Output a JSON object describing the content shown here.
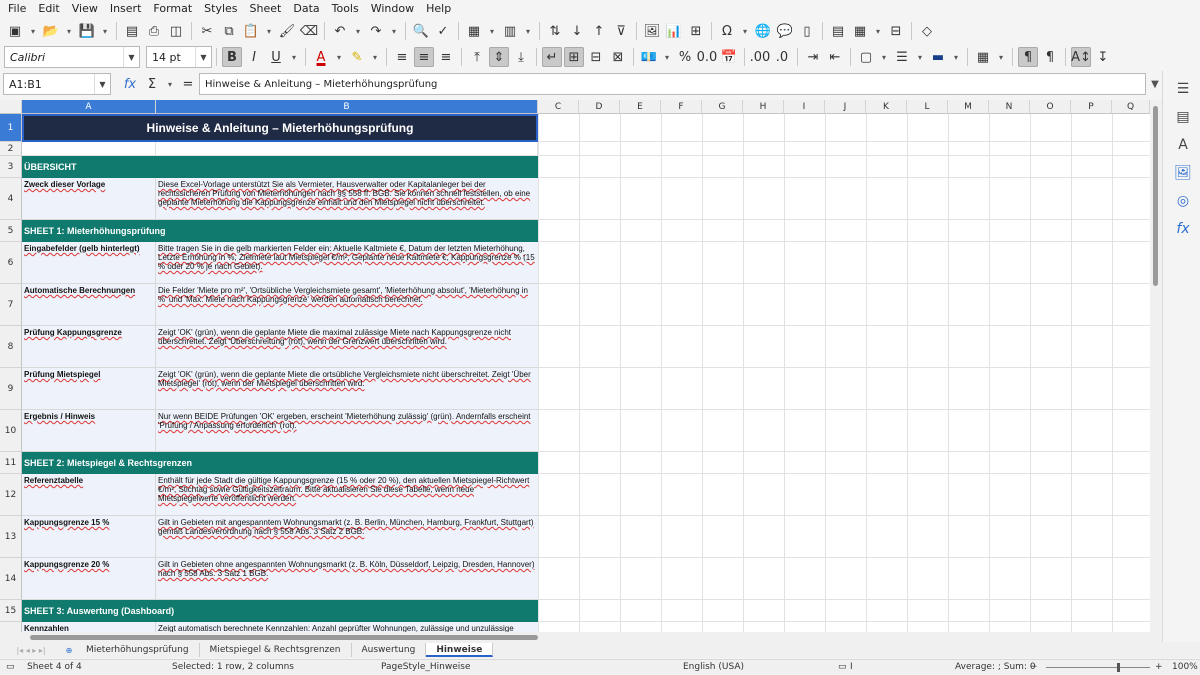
{
  "menu": [
    "File",
    "Edit",
    "View",
    "Insert",
    "Format",
    "Styles",
    "Sheet",
    "Data",
    "Tools",
    "Window",
    "Help"
  ],
  "font": {
    "name": "Calibri",
    "size": "14 pt"
  },
  "name_box": "A1:B1",
  "formula": "Hinweise & Anleitung – Mieterhöhungsprüfung",
  "columns": [
    {
      "label": "A"
    },
    {
      "label": "B"
    },
    {
      "label": "C"
    },
    {
      "label": "D"
    },
    {
      "label": "E"
    },
    {
      "label": "F"
    },
    {
      "label": "G"
    },
    {
      "label": "H"
    },
    {
      "label": "I"
    },
    {
      "label": "J"
    },
    {
      "label": "K"
    },
    {
      "label": "L"
    },
    {
      "label": "M"
    },
    {
      "label": "N"
    },
    {
      "label": "O"
    },
    {
      "label": "P"
    },
    {
      "label": "Q"
    }
  ],
  "rows": [
    {
      "n": "1",
      "kind": "title",
      "text": "Hinweise & Anleitung – Mieterhöhungsprüfung"
    },
    {
      "n": "2",
      "kind": "blank"
    },
    {
      "n": "3",
      "kind": "section",
      "text": "ÜBERSICHT"
    },
    {
      "n": "4",
      "kind": "item",
      "label": "Zweck dieser Vorlage",
      "text": "Diese Excel-Vorlage unterstützt Sie als Vermieter, Hausverwalter oder Kapitalanleger bei der rechtssicheren Prüfung von Mieterhöhungen nach §§ 558 ff. BGB. Sie können schnell feststellen, ob eine geplante Mieterhöhung die Kappungsgrenze einhält und den Mietspiegel nicht überschreitet."
    },
    {
      "n": "5",
      "kind": "section",
      "text": "SHEET 1: Mieterhöhungsprüfung"
    },
    {
      "n": "6",
      "kind": "item",
      "label": "Eingabefelder (gelb hinterlegt)",
      "text": "Bitte tragen Sie in die gelb markierten Felder ein: Aktuelle Kaltmiete €, Datum der letzten Mieterhöhung, Letzte Erhöhung in %, Zielmiete laut Mietspiegel €/m², Geplante neue Kaltmiete €, Kappungsgrenze % (15 % oder 20 % je nach Gebiet)."
    },
    {
      "n": "7",
      "kind": "item",
      "label": "Automatische Berechnungen",
      "text": "Die Felder 'Miete pro m²', 'Ortsübliche Vergleichsmiete gesamt', 'Mieterhöhung absolut', 'Mieterhöhung in %' und 'Max. Miete nach Kappungsgrenze' werden automatisch berechnet."
    },
    {
      "n": "8",
      "kind": "item",
      "label": "Prüfung Kappungsgrenze",
      "text": "Zeigt 'OK' (grün), wenn die geplante Miete die maximal zulässige Miete nach Kappungsgrenze nicht überschreitet. Zeigt 'Überschreitung' (rot), wenn der Grenzwert überschritten wird."
    },
    {
      "n": "9",
      "kind": "item",
      "label": "Prüfung Mietspiegel",
      "text": "Zeigt 'OK' (grün), wenn die geplante Miete die ortsübliche Vergleichsmiete nicht überschreitet. Zeigt 'Über Mietspiegel' (rot), wenn der Mietspiegel überschritten wird."
    },
    {
      "n": "10",
      "kind": "item",
      "label": "Ergebnis / Hinweis",
      "text": "Nur wenn BEIDE Prüfungen 'OK' ergeben, erscheint 'Mieterhöhung zulässig' (grün). Andernfalls erscheint 'Prüfung / Anpassung erforderlich' (rot)."
    },
    {
      "n": "11",
      "kind": "section",
      "text": "SHEET 2: Mietspiegel & Rechtsgrenzen"
    },
    {
      "n": "12",
      "kind": "item",
      "label": "Referenztabelle",
      "text": "Enthält für jede Stadt die gültige Kappungsgrenze (15 % oder 20 %), den aktuellen Mietspiegel-Richtwert €/m², Stichtag sowie Gültigkeitszeitraum. Bitte aktualisieren Sie diese Tabelle, wenn neue Mietspiegelwerte veröffentlicht werden."
    },
    {
      "n": "13",
      "kind": "item",
      "label": "Kappungsgrenze 15 %",
      "text": "Gilt in Gebieten mit angespanntem Wohnungsmarkt (z. B. Berlin, München, Hamburg, Frankfurt, Stuttgart) gemäß Landesverordnung nach § 558 Abs. 3 Satz 2 BGB."
    },
    {
      "n": "14",
      "kind": "item",
      "label": "Kappungsgrenze 20 %",
      "text": "Gilt in Gebieten ohne angespannten Wohnungsmarkt (z. B. Köln, Düsseldorf, Leipzig, Dresden, Hannover) nach § 558 Abs. 3 Satz 1 BGB."
    },
    {
      "n": "15",
      "kind": "section",
      "text": "SHEET 3: Auswertung (Dashboard)"
    },
    {
      "n": "16",
      "kind": "item",
      "label": "Kennzahlen",
      "text": "Zeigt automatisch berechnete Kennzahlen: Anzahl geprüfter Wohnungen, zulässige und unzulässige Erhöhungen, Durchschnittswerte sowie die gesamte zusätzliche Monatsmiete."
    }
  ],
  "sheet_tabs": [
    "Mieterhöhungsprüfung",
    "Mietspiegel & Rechtsgrenzen",
    "Auswertung",
    "Hinweise"
  ],
  "active_tab": "Hinweise",
  "status": {
    "sheet": "Sheet 4 of 4",
    "selection": "Selected: 1 row, 2 columns",
    "pagestyle": "PageStyle_Hinweise",
    "language": "English (USA)",
    "summary": "Average: ; Sum: 0",
    "zoom": "100%"
  },
  "colors": {
    "title_bg": "#1f2a44",
    "section_bg": "#117a6f",
    "label_bg": "#eef3fb",
    "accent": "#3a7bd5"
  }
}
